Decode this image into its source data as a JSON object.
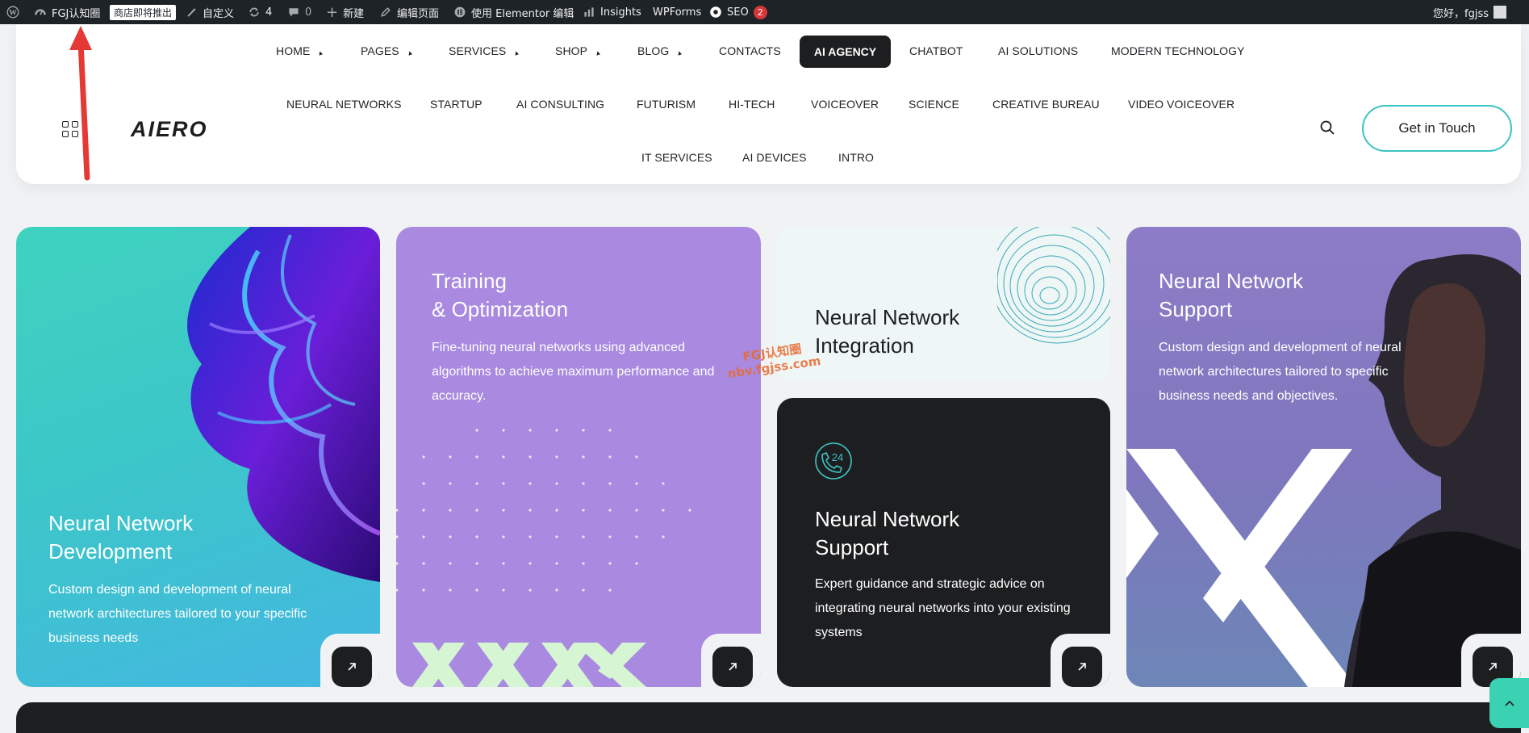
{
  "adminbar": {
    "site_name": "FGJ认知圈",
    "shop_badge": "商店即将推出",
    "customize": "自定义",
    "updates_count": "4",
    "comments_count": "0",
    "new_label": "新建",
    "edit_page": "编辑页面",
    "elementor_edit": "使用 Elementor 编辑",
    "insights": "Insights",
    "wpforms": "WPForms",
    "seo": "SEO",
    "seo_count": "2",
    "greeting": "您好，fgjss"
  },
  "header": {
    "logo_text": "AIERO",
    "cta_label": "Get in Touch",
    "nav_row1": [
      "HOME",
      "PAGES",
      "SERVICES",
      "SHOP",
      "BLOG",
      "CONTACTS",
      "AI AGENCY",
      "CHATBOT",
      "AI SOLUTIONS",
      "MODERN TECHNOLOGY"
    ],
    "nav_row2": [
      "NEURAL NETWORKS",
      "STARTUP",
      "AI CONSULTING",
      "FUTURISM",
      "HI-TECH",
      "VOICEOVER",
      "SCIENCE",
      "CREATIVE BUREAU",
      "VIDEO VOICEOVER"
    ],
    "nav_row3": [
      "IT SERVICES",
      "AI DEVICES",
      "INTRO"
    ]
  },
  "cards": [
    {
      "title": "Neural Network\nDevelopment",
      "desc": "Custom design and development of neural network architectures tailored to your specific business needs"
    },
    {
      "title": "Training\n& Optimization",
      "desc": "Fine-tuning neural networks using advanced algorithms to achieve maximum performance and accuracy."
    },
    {
      "title": "Neural Network\nIntegration",
      "desc": ""
    },
    {
      "title": "Neural Network\nSupport",
      "desc": "Expert guidance and strategic advice on integrating neural networks into your existing systems",
      "icon_text": "24"
    },
    {
      "title": "Neural Network\nSupport",
      "desc": "Custom design and development of neural network architectures tailored to specific business needs and objectives."
    }
  ],
  "watermark": {
    "line1": "FGJ认知圈",
    "line2": "nbv.fgjss.com"
  },
  "colors": {
    "accent": "#3cc3c4",
    "dark": "#1d1e20",
    "purple": "#a98ae0",
    "teal": "#3fd2bf"
  }
}
